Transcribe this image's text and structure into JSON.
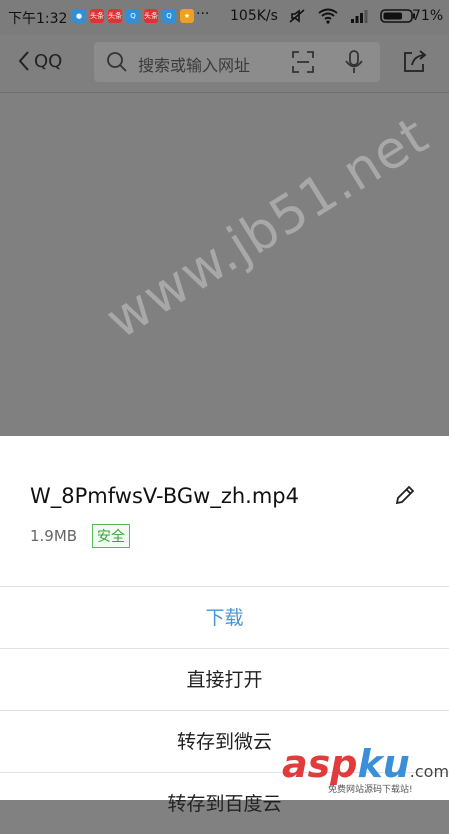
{
  "status_bar": {
    "time": "下午1:32",
    "app_icons": [
      {
        "name": "cloud-app-icon",
        "color": "#2f8fd8",
        "glyph": "●"
      },
      {
        "name": "toutiao-app-icon",
        "color": "#d33",
        "glyph": "头条"
      },
      {
        "name": "toutiao-app-icon-2",
        "color": "#d33",
        "glyph": "头条"
      },
      {
        "name": "qq-app-icon",
        "color": "#2f8fd8",
        "glyph": "Q"
      },
      {
        "name": "toutiao-app-icon-3",
        "color": "#d33",
        "glyph": "头条"
      },
      {
        "name": "qq-app-icon-2",
        "color": "#2f8fd8",
        "glyph": "Q"
      },
      {
        "name": "shop-app-icon",
        "color": "#f0a020",
        "glyph": "★"
      }
    ],
    "overflow": "···",
    "net_speed": "105K/s",
    "battery": "71%"
  },
  "nav": {
    "back_label": "QQ",
    "search_placeholder": "搜索或输入网址"
  },
  "file": {
    "name": "W_8PmfwsV-BGw_zh.mp4",
    "size": "1.9MB",
    "safety_badge": "安全"
  },
  "actions": [
    "下载",
    "直接打开",
    "转存到微云",
    "转存到百度云"
  ],
  "watermarks": {
    "center": "www.jb51.net",
    "brand_asp": "asp",
    "brand_ku": "ku",
    "brand_suffix": ".com",
    "brand_sub": "免费网站源码下载站!"
  },
  "colors": {
    "primary_action": "#4a94cf",
    "safe_green": "#3aa63a"
  }
}
